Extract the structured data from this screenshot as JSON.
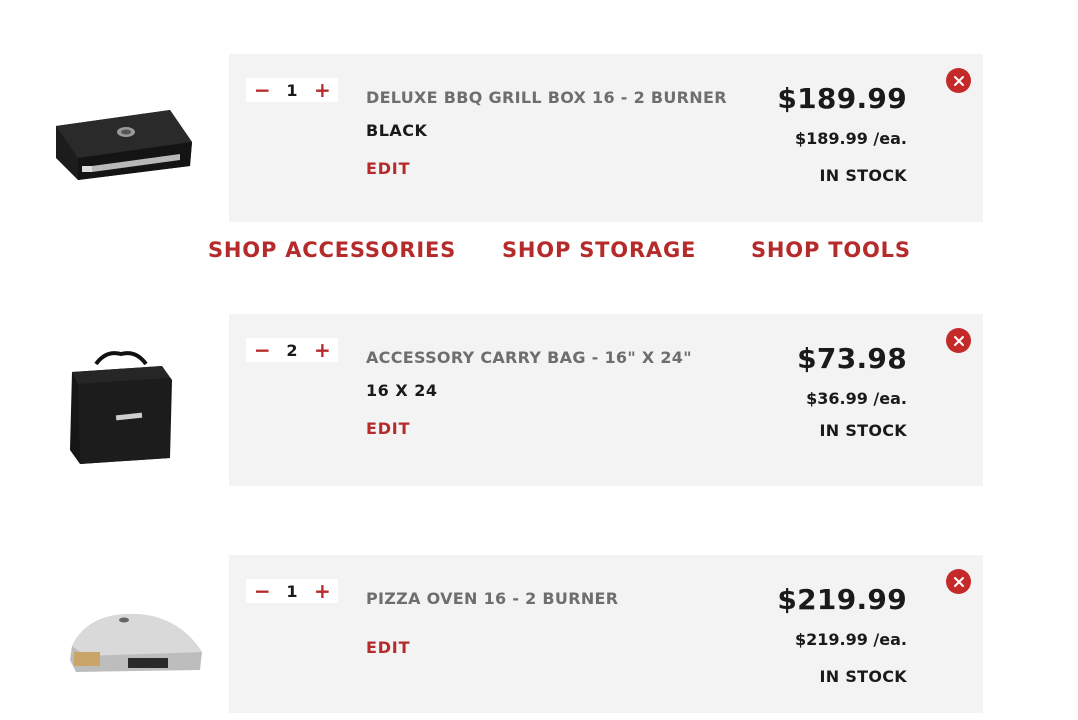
{
  "cart": {
    "items": [
      {
        "quantity": "1",
        "name": "DELUXE BBQ GRILL BOX 16 - 2 BURNER",
        "variant": "BLACK",
        "edit_label": "EDIT",
        "price": "$189.99",
        "unit_price": "$189.99 /ea.",
        "stock_status": "IN STOCK",
        "image": "bbq-grill-box-image"
      },
      {
        "quantity": "2",
        "name": "ACCESSORY CARRY BAG - 16\" X 24\"",
        "variant": "16 X 24",
        "edit_label": "EDIT",
        "price": "$73.98",
        "unit_price": "$36.99 /ea.",
        "stock_status": "IN STOCK",
        "image": "carry-bag-image"
      },
      {
        "quantity": "1",
        "name": "PIZZA OVEN 16 - 2 BURNER",
        "variant": "",
        "edit_label": "EDIT",
        "price": "$219.99",
        "unit_price": "$219.99 /ea.",
        "stock_status": "IN STOCK",
        "image": "pizza-oven-image"
      }
    ],
    "decrement_symbol": "−",
    "increment_symbol": "+"
  },
  "shop_links": {
    "accessories": "SHOP ACCESSORIES",
    "storage": "SHOP STORAGE",
    "tools": "SHOP TOOLS"
  },
  "colors": {
    "accent": "#b52a2a",
    "remove_button": "#c42a2a",
    "card_background": "#f3f3f3",
    "product_name": "#6e6e6e"
  },
  "icons": {
    "remove": "close-circle-icon",
    "decrement": "minus-icon",
    "increment": "plus-icon"
  }
}
